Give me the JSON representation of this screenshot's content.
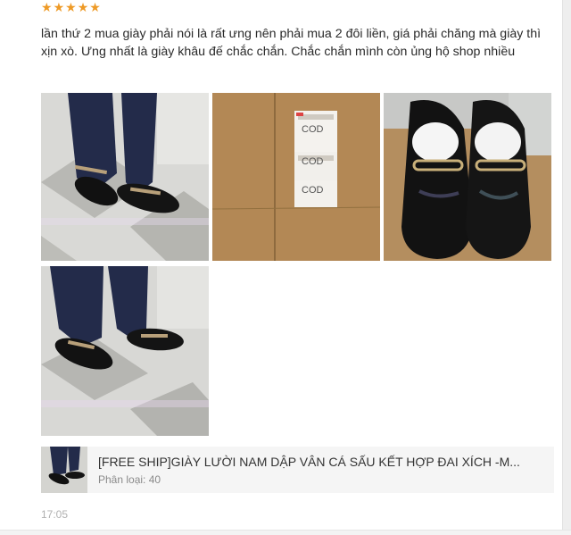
{
  "review": {
    "rating": 5,
    "star_icon": "star-icon",
    "star_color": "#ee9a26",
    "text": "lần thứ 2 mua giày phải nói là rất ưng nên phải mua 2 đôi liền, giá phải chăng mà giày thì xịn xò. Ưng nhất là giày khâu đế chắc chắn. Chắc chắn mình còn ủng hộ shop nhiều",
    "photos": [
      {
        "name": "review-photo-1"
      },
      {
        "name": "review-photo-2",
        "labels": [
          "COD",
          "COD",
          "COD"
        ]
      },
      {
        "name": "review-photo-3"
      },
      {
        "name": "review-photo-4"
      }
    ]
  },
  "product": {
    "title": "[FREE SHIP]GIÀY LƯỜI NAM DẬP VÂN CÁ SẤU KẾT HỢP ĐAI XÍCH -M...",
    "variant": "Phân loại: 40"
  },
  "timestamp": "17:05"
}
